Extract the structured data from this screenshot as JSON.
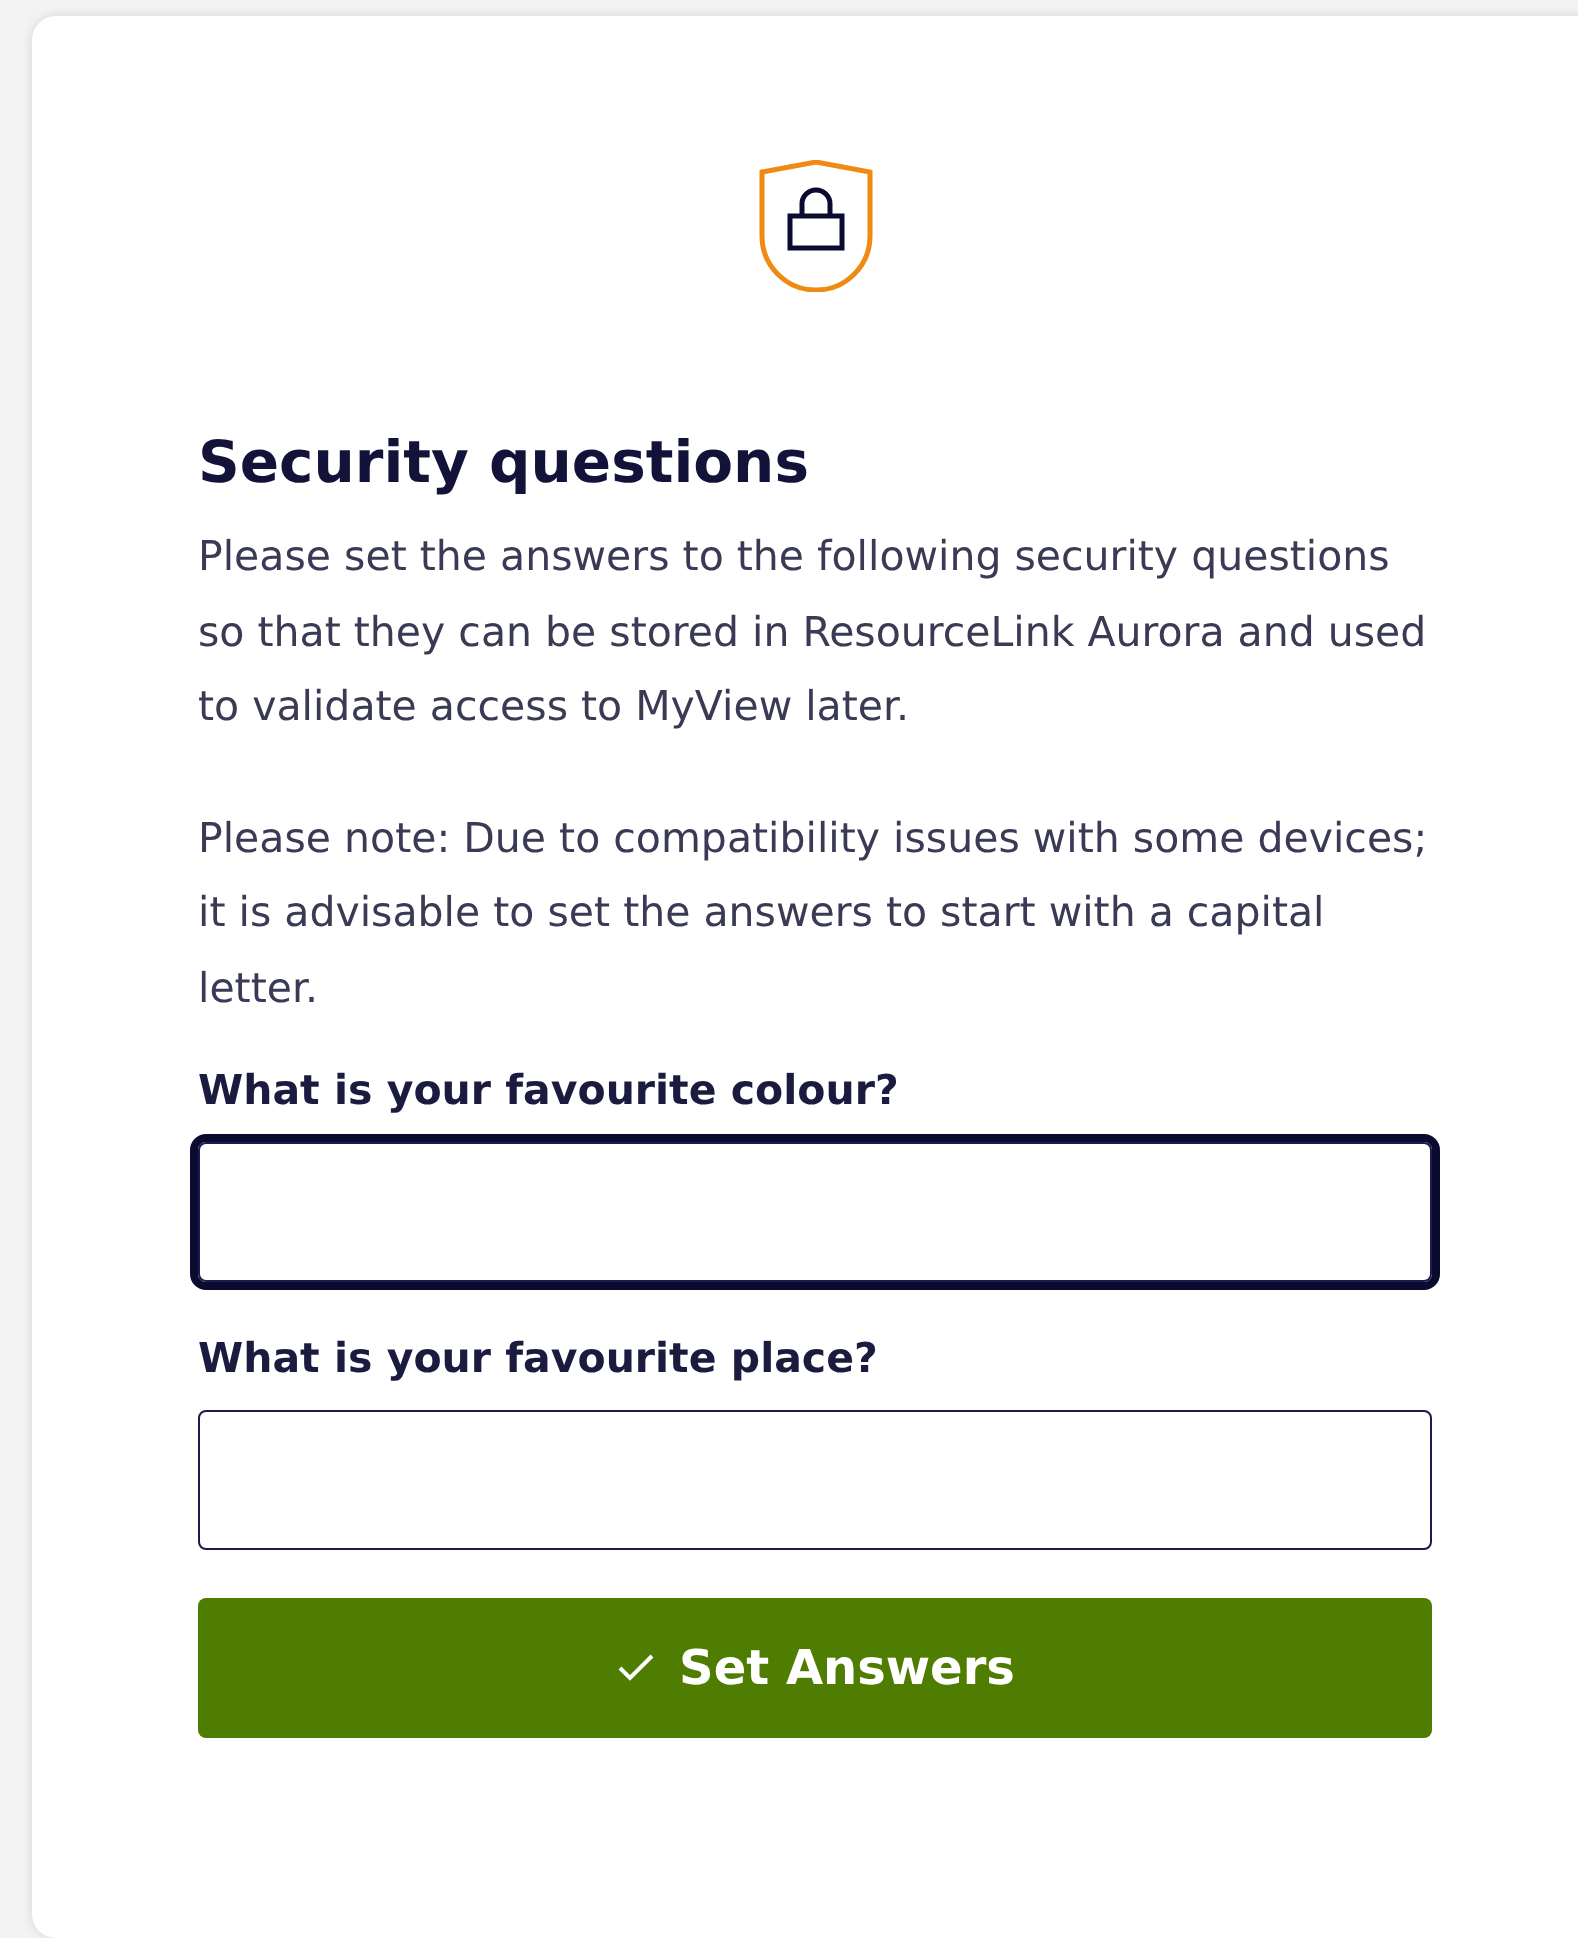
{
  "title": "Security questions",
  "paragraphs": [
    "Please set the answers to the following security questions so that they can be stored in ResourceLink Aurora and used to validate access to MyView later.",
    "Please note: Due to compatibility issues with some devices; it is advisable to set the answers to start with a capital letter."
  ],
  "questions": [
    {
      "label": "What is your favourite colour?",
      "focused": true
    },
    {
      "label": "What is your favourite place?",
      "focused": false
    }
  ],
  "button": {
    "label": "Set Answers"
  }
}
